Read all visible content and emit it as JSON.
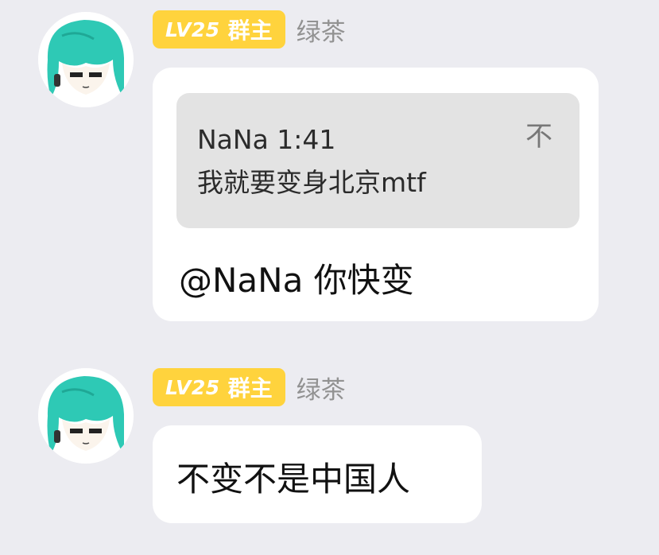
{
  "messages": [
    {
      "level": "LV25",
      "role": "群主",
      "sender": "绿茶",
      "quote": {
        "author_time": "NaNa 1:41",
        "text": "我就要变身北京mtf",
        "jump_icon": "不"
      },
      "text": "@NaNa 你快变"
    },
    {
      "level": "LV25",
      "role": "群主",
      "sender": "绿茶",
      "text": "不变不是中国人"
    }
  ],
  "colors": {
    "background": "#ececf1",
    "badge": "#ffd33d",
    "bubble": "#ffffff",
    "quote_bg": "#e3e3e3",
    "sender_name": "#929292",
    "avatar_hair": "#2ec9b5"
  },
  "icons": {
    "avatar": "anime-avatar-icon"
  }
}
